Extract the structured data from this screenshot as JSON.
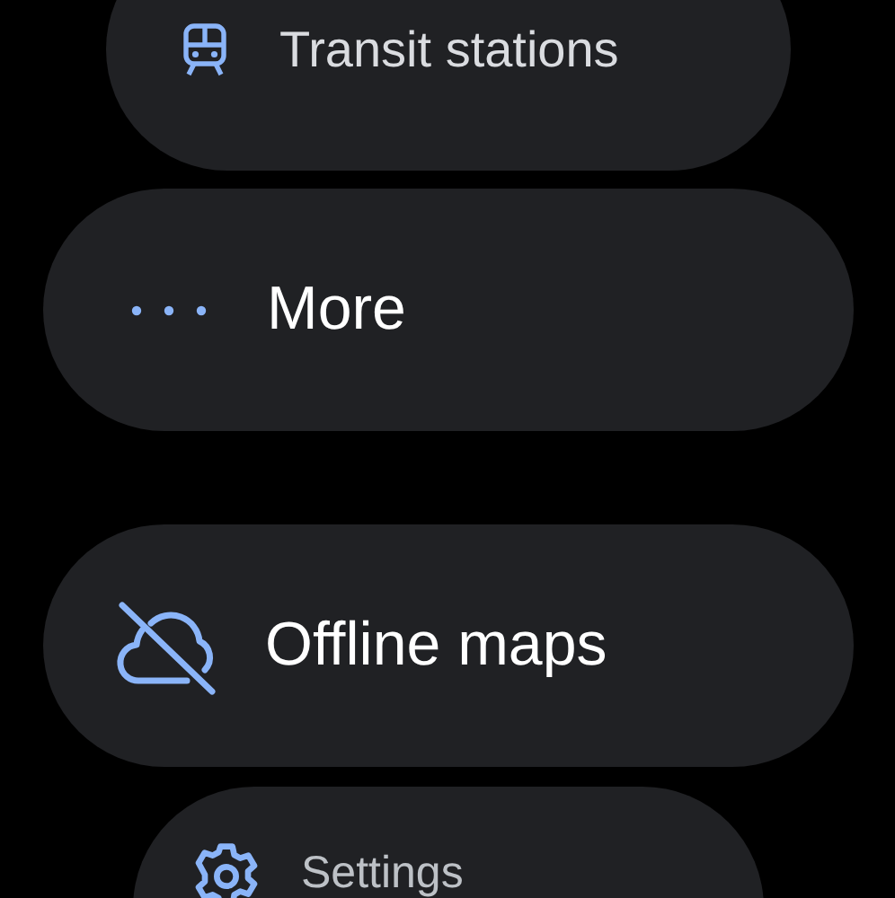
{
  "menu_items": [
    {
      "label": "Transit stations",
      "kind": "transit"
    },
    {
      "label": "More",
      "kind": "more"
    },
    {
      "label": "Offline maps",
      "kind": "offline"
    },
    {
      "label": "Settings",
      "kind": "settings"
    }
  ]
}
